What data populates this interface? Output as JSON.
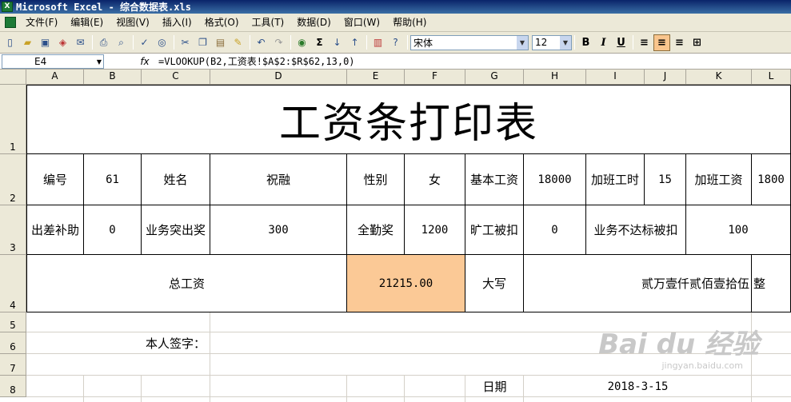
{
  "window": {
    "title": "Microsoft Excel - 综合数据表.xls"
  },
  "menu": [
    "文件(F)",
    "编辑(E)",
    "视图(V)",
    "插入(I)",
    "格式(O)",
    "工具(T)",
    "数据(D)",
    "窗口(W)",
    "帮助(H)"
  ],
  "toolbar": {
    "font_name": "宋体",
    "font_size": "12",
    "bold": "B",
    "italic": "I",
    "underline": "U",
    "sum": "Σ"
  },
  "formula_bar": {
    "cell_ref": "E4",
    "fx": "fx",
    "formula": "=VLOOKUP(B2,工资表!$A$2:$R$62,13,0)"
  },
  "columns": [
    "A",
    "B",
    "C",
    "D",
    "E",
    "F",
    "G",
    "H",
    "I",
    "J",
    "K",
    "L"
  ],
  "rows": [
    "1",
    "2",
    "3",
    "4",
    "5",
    "6",
    "7",
    "8"
  ],
  "sheet": {
    "title": "工资条打印表",
    "r2": {
      "label_id": "编号",
      "id": "61",
      "label_name": "姓名",
      "name": "祝融",
      "label_gender": "性别",
      "gender": "女",
      "label_base": "基本工资",
      "base": "18000",
      "label_ot_hours": "加班工时",
      "ot_hours": "15",
      "label_ot_pay": "加班工资",
      "ot_pay": "1800"
    },
    "r3": {
      "label_travel": "出差补助",
      "travel": "0",
      "label_bonus": "业务突出奖",
      "bonus": "300",
      "label_attendance": "全勤奖",
      "attendance": "1200",
      "label_absence": "旷工被扣",
      "absence": "0",
      "label_penalty": "业务不达标被扣",
      "penalty": "100"
    },
    "r4": {
      "label_total": "总工资",
      "total": "21215.00",
      "label_upper": "大写",
      "upper": "贰万壹仟贰佰壹拾伍",
      "upper_suffix": "整"
    },
    "signature_label": "本人签字：",
    "date_label": "日期",
    "date": "2018-3-15"
  },
  "watermark": {
    "text": "Bai du 经验",
    "sub": "jingyan.baidu.com"
  }
}
